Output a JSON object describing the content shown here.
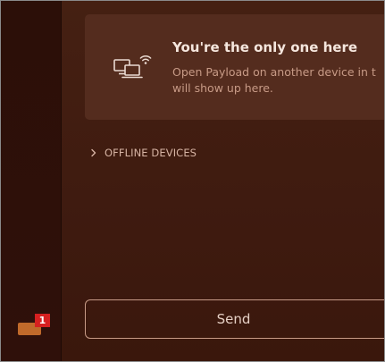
{
  "sidebar": {
    "tray": {
      "icon": "tray-icon",
      "badge_count": "1"
    }
  },
  "empty_state": {
    "icon": "cast-device-icon",
    "title": "You're the only one here",
    "description_line1": "Open Payload on another device in t",
    "description_line2": "will show up here."
  },
  "offline_devices": {
    "label": "OFFLINE DEVICES",
    "icon": "chevron-right-icon",
    "expanded": false
  },
  "send_button": {
    "label": "Send"
  },
  "colors": {
    "background": "#452012",
    "sidebar": "#2c0f08",
    "card": "#542c1e",
    "accent": "#c06a2b",
    "badge": "#d62020",
    "text_primary": "#f5e6dd",
    "text_secondary": "#c79a86"
  }
}
